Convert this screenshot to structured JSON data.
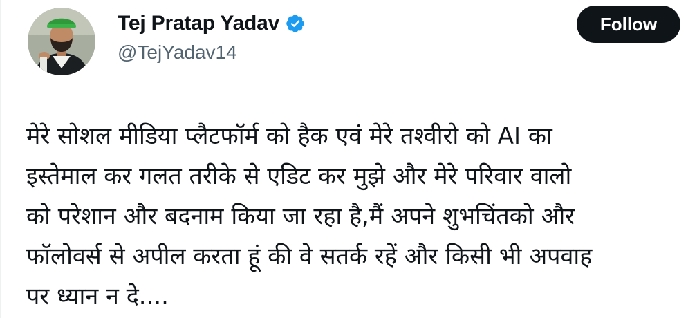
{
  "author": {
    "display_name": "Tej Pratap Yadav",
    "handle": "@TejYadav14",
    "verified": true,
    "verified_color": "#1d9bf0",
    "avatar_icon": "profile-photo"
  },
  "follow_button": {
    "label": "Follow",
    "background": "#0f1419",
    "text_color": "#ffffff"
  },
  "tweet": {
    "lines": [
      "मेरे सोशल मीडिया प्लैटफॉर्म को हैक एवं मेरे तश्वीरो को AI का",
      "इस्तेमाल कर गलत तरीके से एडिट कर मुझे और मेरे परिवार वालो",
      "को परेशान और बदनाम किया जा रहा है,मैं अपने शुभचिंतको और",
      "फॉलोवर्स से अपील करता हूं की वे सतर्क रहें और किसी भी अपवाह",
      "पर ध्यान न दे...."
    ]
  }
}
